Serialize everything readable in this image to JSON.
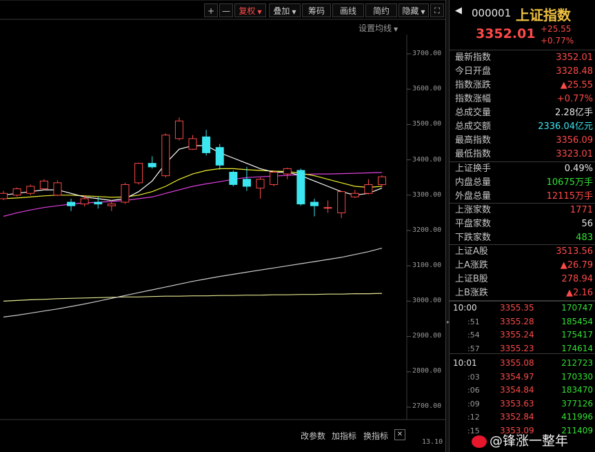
{
  "toolbar": {
    "plus": "+",
    "minus": "—",
    "fuquan": "复权",
    "diejia": "叠加",
    "choumа": "筹码",
    "huaxian": "画线",
    "jianyue": "简约",
    "yincang": "隐藏",
    "expand": "⛶",
    "setting_ma": "设置均线"
  },
  "axis": {
    "ticks": [
      "3700.00",
      "3600.00",
      "3500.00",
      "3400.00",
      "3300.00",
      "3200.00",
      "3100.00",
      "3000.00",
      "2900.00",
      "2800.00",
      "2700.00"
    ],
    "bottom_value": "13.10"
  },
  "bottom_bar": {
    "change_params": "改参数",
    "add_indicator": "加指标",
    "switch_indicator": "换指标",
    "close": "✕"
  },
  "header": {
    "code": "000001",
    "name": "上证指数",
    "price": "3352.01",
    "change": "+25.55",
    "change_pct": "+0.77%"
  },
  "stats": [
    {
      "label": "最新指数",
      "value": "3352.01",
      "color": "red"
    },
    {
      "label": "今日开盘",
      "value": "3328.48",
      "color": "red"
    },
    {
      "label": "指数涨跌",
      "value": "▲25.55",
      "color": "red"
    },
    {
      "label": "指数涨幅",
      "value": "+0.77%",
      "color": "red"
    },
    {
      "label": "总成交量",
      "value": "2.28亿手",
      "color": "white"
    },
    {
      "label": "总成交额",
      "value": "2336.04亿元",
      "color": "cyan"
    },
    {
      "label": "最高指数",
      "value": "3356.09",
      "color": "red"
    },
    {
      "label": "最低指数",
      "value": "3323.01",
      "color": "red"
    }
  ],
  "stats2": [
    {
      "label": "上证换手",
      "value": "0.49%",
      "color": "white"
    },
    {
      "label": "内盘总量",
      "value": "10675万手",
      "color": "green"
    },
    {
      "label": "外盘总量",
      "value": "12115万手",
      "color": "red"
    }
  ],
  "stats3": [
    {
      "label": "上涨家数",
      "value": "1771",
      "color": "red"
    },
    {
      "label": "平盘家数",
      "value": "56",
      "color": "white"
    },
    {
      "label": "下跌家数",
      "value": "483",
      "color": "green"
    }
  ],
  "stats4": [
    {
      "label": "上证A股",
      "value": "3513.56",
      "color": "red"
    },
    {
      "label": "上A涨跌",
      "value": "▲26.79",
      "color": "red"
    },
    {
      "label": "上证B股",
      "value": "278.94",
      "color": "red"
    },
    {
      "label": "上B涨跌",
      "value": "▲2.16",
      "color": "red"
    }
  ],
  "ticks": [
    {
      "time": "10:00",
      "price": "3355.35",
      "vol": "170747",
      "sec": false
    },
    {
      "time": ":51",
      "price": "3355.28",
      "vol": "185454",
      "sec": true
    },
    {
      "time": ":54",
      "price": "3355.24",
      "vol": "175417",
      "sec": true
    },
    {
      "time": ":57",
      "price": "3355.23",
      "vol": "174614",
      "sec": true
    },
    {
      "time": "10:01",
      "price": "3355.08",
      "vol": "212723",
      "sec": false
    },
    {
      "time": ":03",
      "price": "3354.97",
      "vol": "170330",
      "sec": true
    },
    {
      "time": ":06",
      "price": "3354.84",
      "vol": "183470",
      "sec": true
    },
    {
      "time": ":09",
      "price": "3353.63",
      "vol": "377126",
      "sec": true
    },
    {
      "time": ":12",
      "price": "3352.84",
      "vol": "411996",
      "sec": true
    },
    {
      "time": ":15",
      "price": "3353.09",
      "vol": "211409",
      "sec": true
    }
  ],
  "watermark": "@锋涨一整年",
  "chart_data": {
    "type": "candlestick",
    "ylim": [
      2650,
      3760
    ],
    "candles": [
      {
        "o": 3290,
        "c": 3305,
        "h": 3312,
        "l": 3286
      },
      {
        "o": 3300,
        "c": 3318,
        "h": 3322,
        "l": 3296
      },
      {
        "o": 3305,
        "c": 3325,
        "h": 3330,
        "l": 3300
      },
      {
        "o": 3318,
        "c": 3340,
        "h": 3345,
        "l": 3315
      },
      {
        "o": 3300,
        "c": 3335,
        "h": 3342,
        "l": 3298
      },
      {
        "o": 3280,
        "c": 3270,
        "h": 3290,
        "l": 3255
      },
      {
        "o": 3275,
        "c": 3290,
        "h": 3300,
        "l": 3268
      },
      {
        "o": 3280,
        "c": 3275,
        "h": 3295,
        "l": 3262
      },
      {
        "o": 3270,
        "c": 3275,
        "h": 3286,
        "l": 3255
      },
      {
        "o": 3280,
        "c": 3330,
        "h": 3335,
        "l": 3275
      },
      {
        "o": 3335,
        "c": 3390,
        "h": 3392,
        "l": 3330
      },
      {
        "o": 3390,
        "c": 3380,
        "h": 3410,
        "l": 3375
      },
      {
        "o": 3355,
        "c": 3470,
        "h": 3475,
        "l": 3350
      },
      {
        "o": 3460,
        "c": 3510,
        "h": 3520,
        "l": 3455
      },
      {
        "o": 3430,
        "c": 3460,
        "h": 3470,
        "l": 3428
      },
      {
        "o": 3465,
        "c": 3420,
        "h": 3485,
        "l": 3412
      },
      {
        "o": 3435,
        "c": 3385,
        "h": 3445,
        "l": 3372
      },
      {
        "o": 3365,
        "c": 3330,
        "h": 3370,
        "l": 3325
      },
      {
        "o": 3345,
        "c": 3325,
        "h": 3380,
        "l": 3312
      },
      {
        "o": 3320,
        "c": 3345,
        "h": 3350,
        "l": 3290
      },
      {
        "o": 3330,
        "c": 3365,
        "h": 3370,
        "l": 3325
      },
      {
        "o": 3360,
        "c": 3375,
        "h": 3378,
        "l": 3345
      },
      {
        "o": 3370,
        "c": 3275,
        "h": 3375,
        "l": 3270
      },
      {
        "o": 3280,
        "c": 3270,
        "h": 3290,
        "l": 3240
      },
      {
        "o": 3265,
        "c": 3265,
        "h": 3285,
        "l": 3250
      },
      {
        "o": 3250,
        "c": 3310,
        "h": 3312,
        "l": 3235
      },
      {
        "o": 3295,
        "c": 3305,
        "h": 3315,
        "l": 3292
      },
      {
        "o": 3305,
        "c": 3330,
        "h": 3345,
        "l": 3302
      },
      {
        "o": 3330,
        "c": 3352,
        "h": 3356,
        "l": 3323
      }
    ],
    "ma_short": [
      3300,
      3305,
      3310,
      3315,
      3315,
      3305,
      3295,
      3290,
      3285,
      3290,
      3310,
      3340,
      3390,
      3430,
      3440,
      3440,
      3420,
      3405,
      3390,
      3375,
      3365,
      3365,
      3355,
      3340,
      3325,
      3310,
      3300,
      3305,
      3320
    ],
    "ma_mid": [
      3290,
      3292,
      3295,
      3298,
      3300,
      3300,
      3298,
      3296,
      3294,
      3295,
      3300,
      3310,
      3325,
      3345,
      3360,
      3370,
      3375,
      3375,
      3372,
      3370,
      3368,
      3367,
      3362,
      3355,
      3345,
      3335,
      3325,
      3322,
      3325
    ],
    "ma_long": [
      3240,
      3250,
      3258,
      3265,
      3270,
      3275,
      3278,
      3280,
      3282,
      3285,
      3290,
      3295,
      3305,
      3315,
      3325,
      3332,
      3338,
      3345,
      3350,
      3352,
      3354,
      3356,
      3358,
      3360,
      3360,
      3361,
      3362,
      3363,
      3364
    ],
    "ma_120": [
      2955,
      2960,
      2966,
      2972,
      2978,
      2985,
      2992,
      3000,
      3008,
      3016,
      3024,
      3032,
      3040,
      3048,
      3056,
      3063,
      3070,
      3076,
      3082,
      3088,
      3094,
      3100,
      3106,
      3112,
      3118,
      3124,
      3132,
      3140,
      3150
    ],
    "ma_250": [
      3000,
      3002,
      3004,
      3005,
      3007,
      3008,
      3009,
      3010,
      3011,
      3012,
      3012,
      3013,
      3014,
      3014,
      3015,
      3015,
      3016,
      3016,
      3017,
      3017,
      3018,
      3018,
      3019,
      3019,
      3020,
      3020,
      3021,
      3021,
      3022
    ]
  }
}
